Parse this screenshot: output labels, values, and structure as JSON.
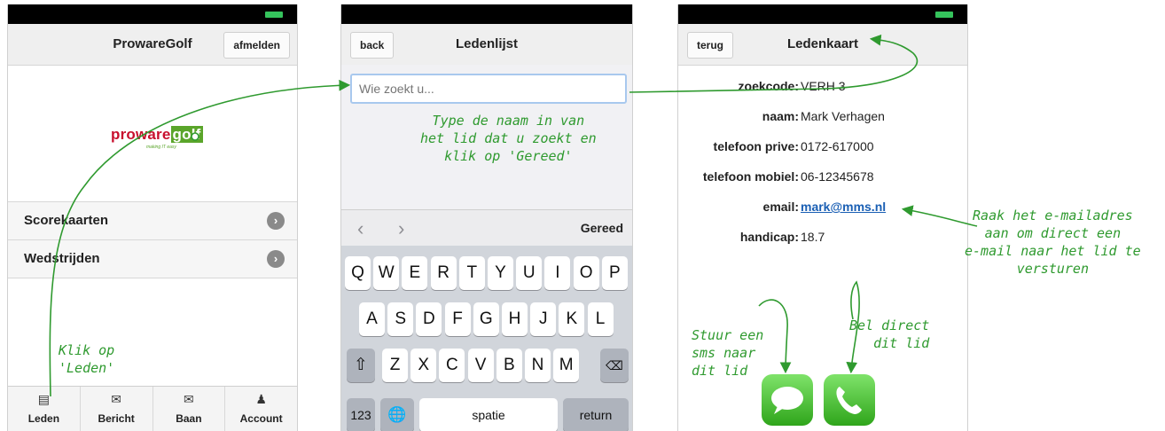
{
  "phone1": {
    "title": "ProwareGolf",
    "logout_button": "afmelden",
    "logo": {
      "word1": "proware",
      "word2": "golf",
      "tagline": "making IT easy"
    },
    "menu": [
      {
        "label": "Scorekaarten"
      },
      {
        "label": "Wedstrijden"
      }
    ],
    "tabs": [
      {
        "label": "Leden",
        "icon": "document-icon"
      },
      {
        "label": "Bericht",
        "icon": "envelope-icon"
      },
      {
        "label": "Baan",
        "icon": "envelope-icon"
      },
      {
        "label": "Account",
        "icon": "person-icon"
      }
    ]
  },
  "phone2": {
    "back_button": "back",
    "title": "Ledenlijst",
    "search_placeholder": "Wie zoekt u...",
    "done_button": "Gereed",
    "keyboard": {
      "row1": [
        "Q",
        "W",
        "E",
        "R",
        "T",
        "Y",
        "U",
        "I",
        "O",
        "P"
      ],
      "row2": [
        "A",
        "S",
        "D",
        "F",
        "G",
        "H",
        "J",
        "K",
        "L"
      ],
      "row3": [
        "Z",
        "X",
        "C",
        "V",
        "B",
        "N",
        "M"
      ],
      "numbers_key": "123",
      "space_key": "spatie",
      "return_key": "return"
    }
  },
  "phone3": {
    "back_button": "terug",
    "title": "Ledenkaart",
    "fields": [
      {
        "label": "zoekcode:",
        "value": "VERH 3"
      },
      {
        "label": "naam:",
        "value": "Mark Verhagen"
      },
      {
        "label": "telefoon prive:",
        "value": "0172-617000"
      },
      {
        "label": "telefoon mobiel:",
        "value": "06-12345678"
      },
      {
        "label": "email:",
        "value": "mark@mms.nl"
      },
      {
        "label": "handicap:",
        "value": "18.7"
      }
    ]
  },
  "annotations": {
    "klik": "Klik op\n'Leden'",
    "type": "Type de naam in van\nhet lid dat u zoekt en\nklik op 'Gereed'",
    "email": "Raak het e-mailadres\naan om direct een\ne-mail naar het lid te\nversturen",
    "sms": "Stuur een\nsms naar\ndit lid",
    "bel": "Bel direct\ndit lid"
  },
  "colors": {
    "accent": "#2f9a2f",
    "link": "#1a5fb4",
    "brand_red": "#c8102e",
    "brand_green": "#5aa52a"
  }
}
